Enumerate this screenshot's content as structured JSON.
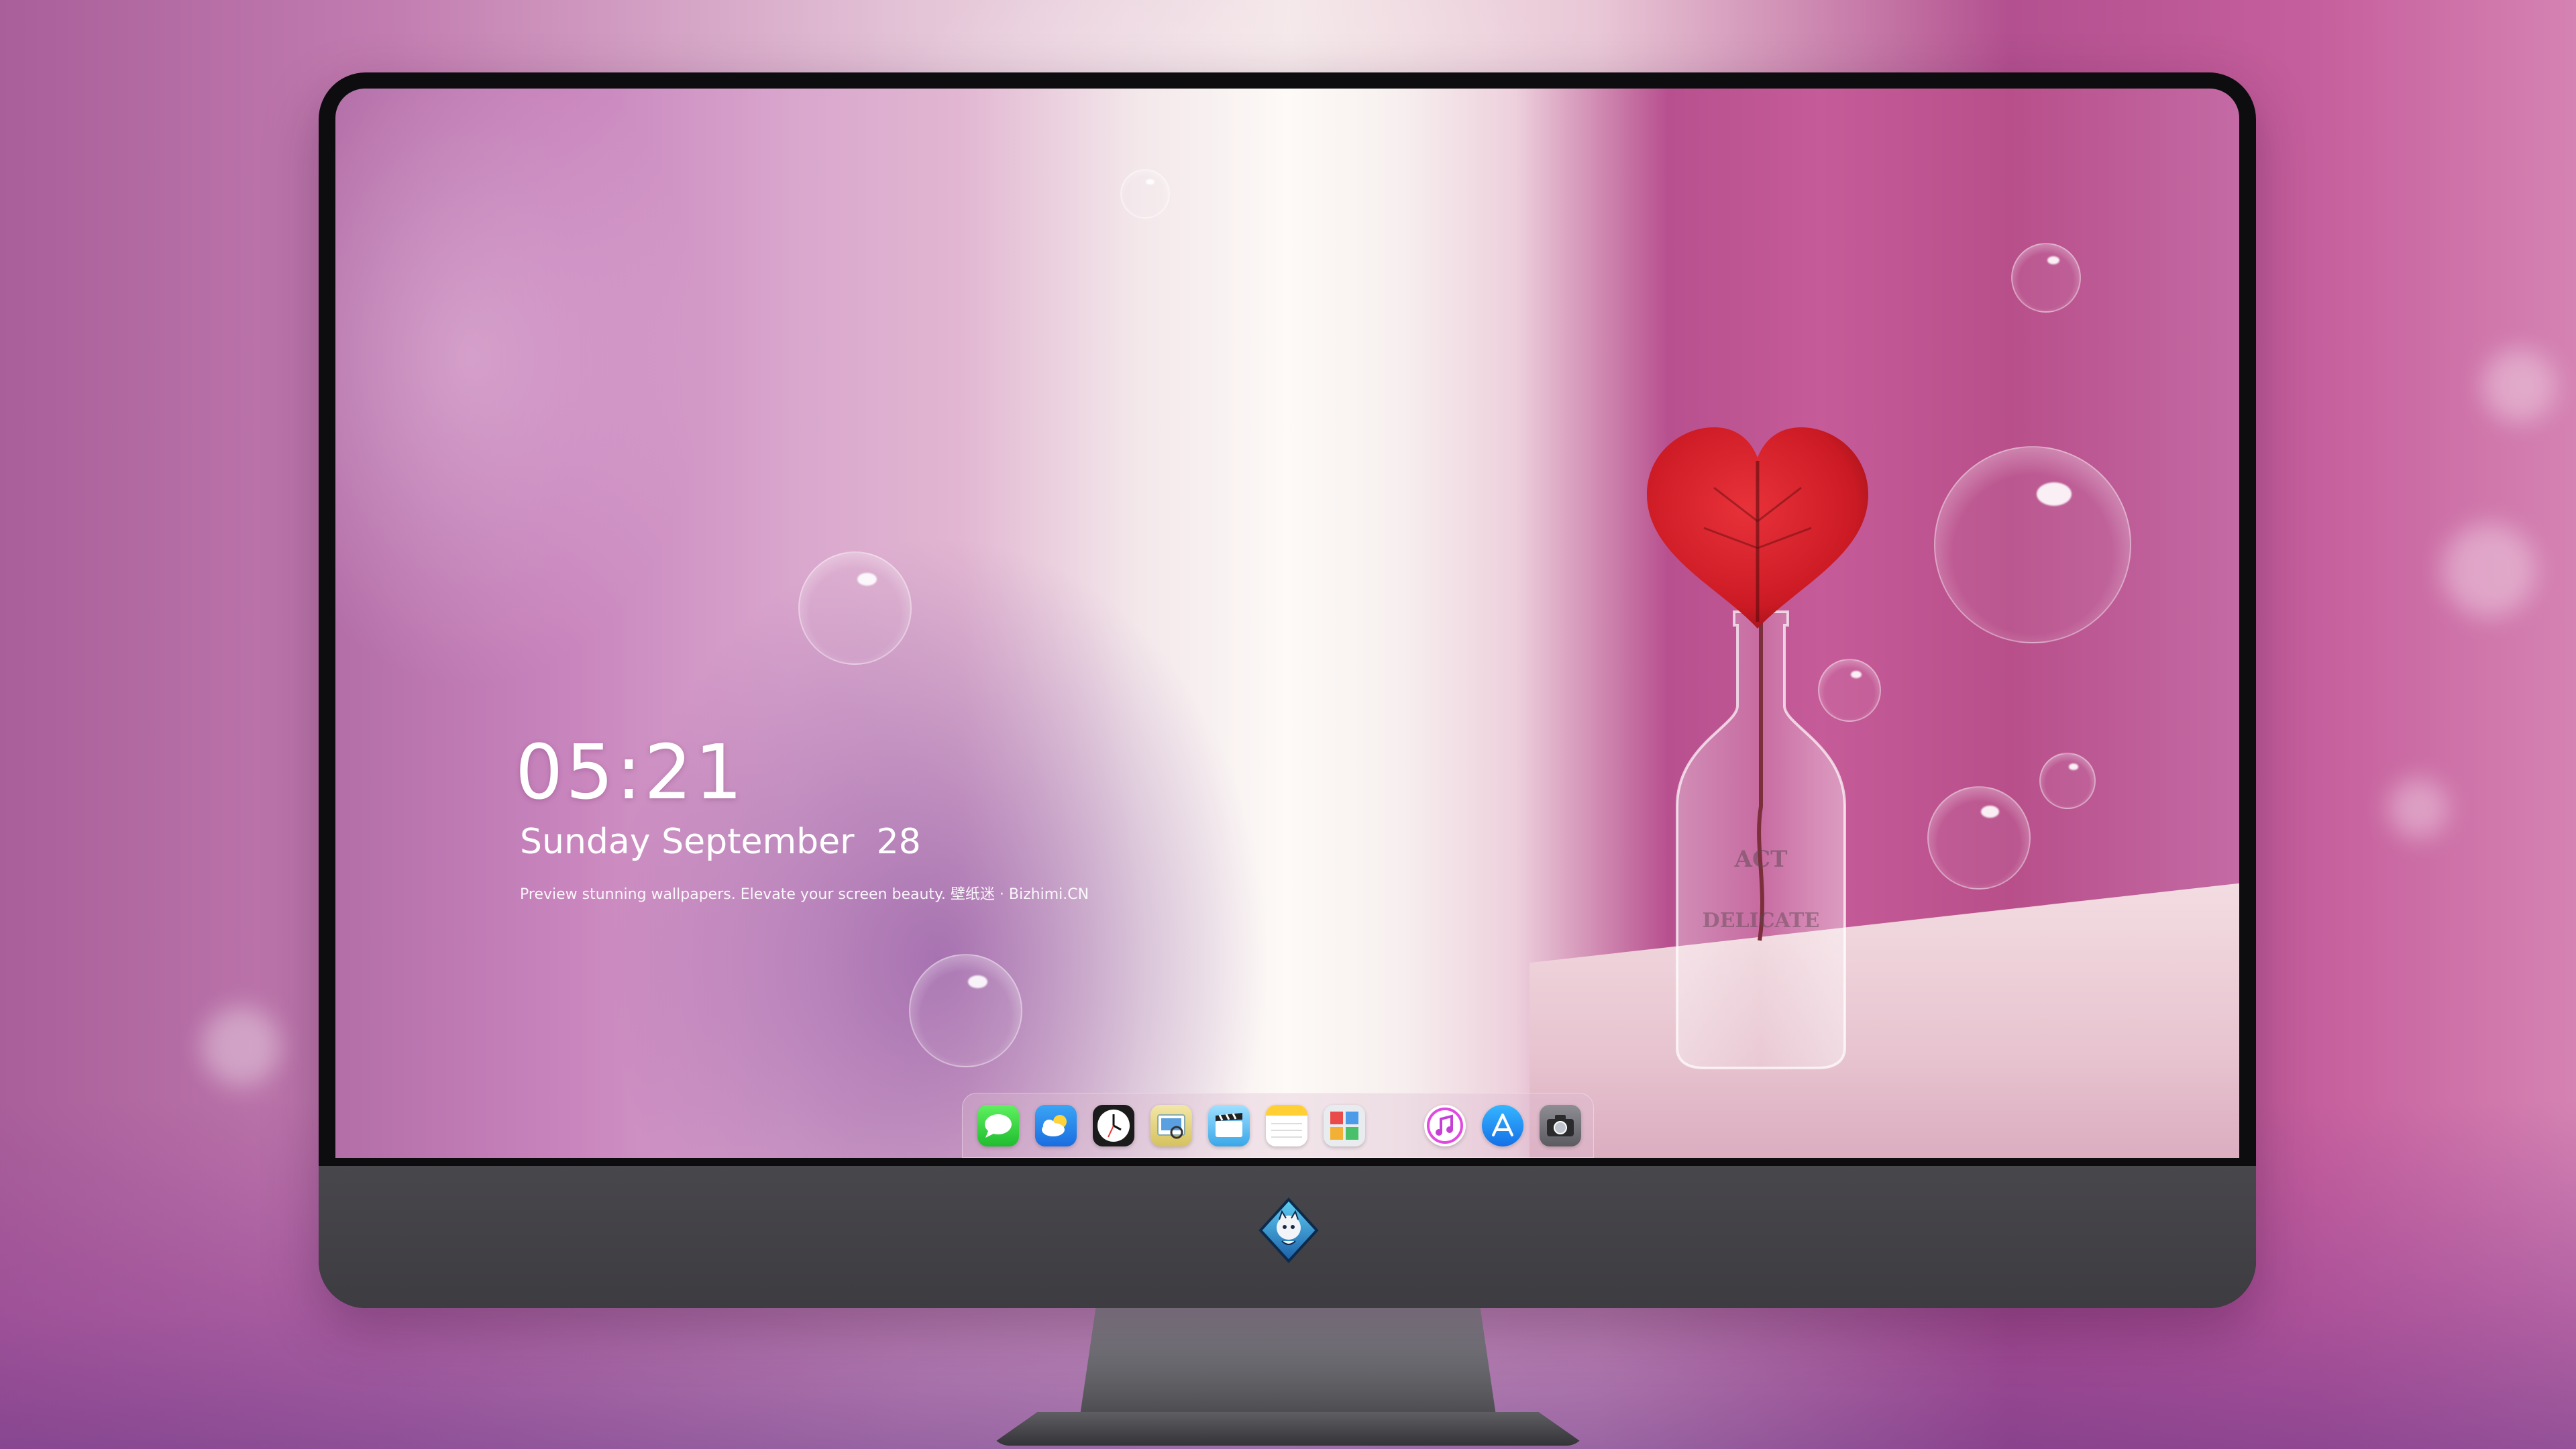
{
  "lock_screen": {
    "time": "05:21",
    "date": "Sunday September  28",
    "tagline": "Preview stunning wallpapers. Elevate your screen beauty. 壁纸迷 · Bizhimi.CN"
  },
  "dock": {
    "apps": [
      {
        "name": "Messages",
        "icon": "message-bubble-icon"
      },
      {
        "name": "Weather",
        "icon": "cloud-sun-icon"
      },
      {
        "name": "Clock",
        "icon": "clock-icon"
      },
      {
        "name": "Preview",
        "icon": "preview-icon"
      },
      {
        "name": "Clips",
        "icon": "clapperboard-icon"
      },
      {
        "name": "Notes",
        "icon": "notes-icon"
      },
      {
        "name": "Photo Booth",
        "icon": "photo-grid-icon"
      }
    ],
    "pinned": [
      {
        "name": "iTunes",
        "icon": "music-note-icon"
      },
      {
        "name": "App Store",
        "icon": "app-store-icon"
      },
      {
        "name": "Camera",
        "icon": "camera-icon"
      }
    ]
  },
  "colors": {
    "accent_pink": "#c55b98",
    "bezel": "#0d0d0f",
    "chin": "#48474c",
    "heart_red": "#d9202a"
  }
}
